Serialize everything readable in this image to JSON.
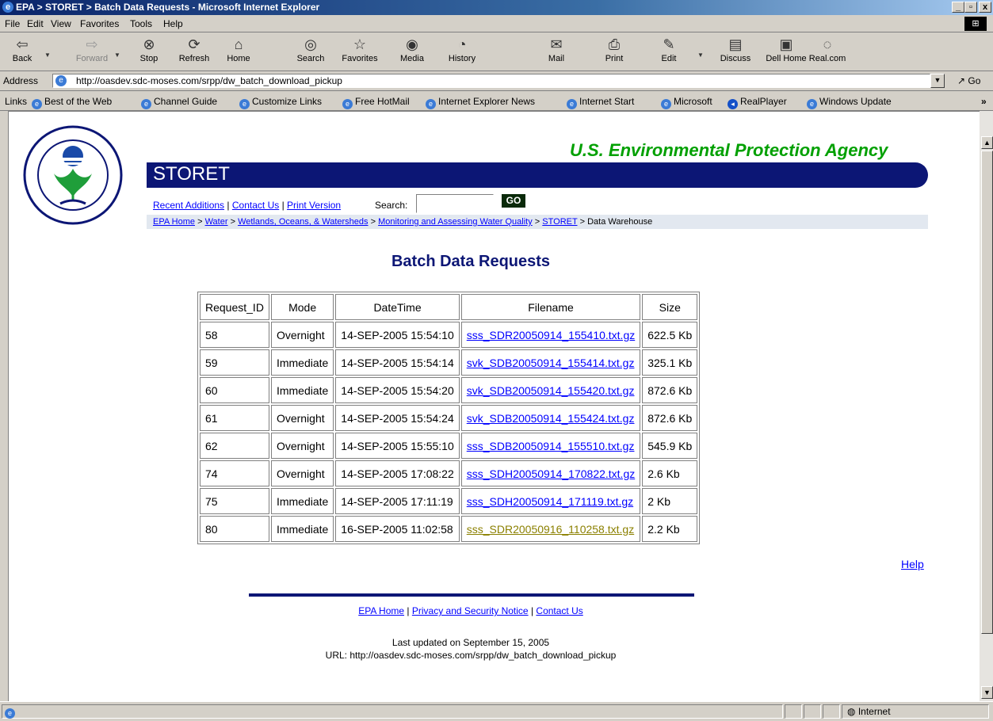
{
  "window": {
    "title": "EPA > STORET > Batch Data Requests - Microsoft Internet Explorer",
    "minimize": "_",
    "maximize": "▫",
    "close": "x"
  },
  "menu": [
    "File",
    "Edit",
    "View",
    "Favorites",
    "Tools",
    "Help"
  ],
  "toolbar": {
    "back": "Back",
    "forward": "Forward",
    "stop": "Stop",
    "refresh": "Refresh",
    "home": "Home",
    "search": "Search",
    "favorites": "Favorites",
    "media": "Media",
    "history": "History",
    "mail": "Mail",
    "print": "Print",
    "edit": "Edit",
    "discuss": "Discuss",
    "dellhome": "Dell Home",
    "real": "Real.com"
  },
  "address": {
    "label": "Address",
    "url": "http://oasdev.sdc-moses.com/srpp/dw_batch_download_pickup",
    "go": "Go"
  },
  "links": {
    "label": "Links",
    "items": [
      "Best of the Web",
      "Channel Guide",
      "Customize Links",
      "Free HotMail",
      "Internet Explorer News",
      "Internet Start",
      "Microsoft",
      "RealPlayer",
      "Windows Update"
    ]
  },
  "page": {
    "agency": "U.S. Environmental Protection Agency",
    "storet": "STORET",
    "nav": {
      "recent": "Recent Additions",
      "contact": "Contact Us",
      "print": "Print Version",
      "sep": "|"
    },
    "search_label": "Search:",
    "search_value": "",
    "go": "GO",
    "breadcrumb": {
      "epa_home": "EPA Home",
      "water": "Water",
      "wetlands": "Wetlands, Oceans, & Watersheds",
      "monitoring": "Monitoring and Assessing Water Quality",
      "storet": "STORET",
      "current": "Data Warehouse",
      "sep": ">"
    },
    "heading": "Batch Data Requests",
    "table": {
      "headers": [
        "Request_ID",
        "Mode",
        "DateTime",
        "Filename",
        "Size"
      ],
      "rows": [
        [
          "58",
          "Overnight",
          "14-SEP-2005 15:54:10",
          "sss_SDR20050914_155410.txt.gz",
          "622.5 Kb"
        ],
        [
          "59",
          "Immediate",
          "14-SEP-2005 15:54:14",
          "svk_SDB20050914_155414.txt.gz",
          "325.1 Kb"
        ],
        [
          "60",
          "Immediate",
          "14-SEP-2005 15:54:20",
          "svk_SDB20050914_155420.txt.gz",
          "872.6 Kb"
        ],
        [
          "61",
          "Overnight",
          "14-SEP-2005 15:54:24",
          "svk_SDB20050914_155424.txt.gz",
          "872.6 Kb"
        ],
        [
          "62",
          "Overnight",
          "14-SEP-2005 15:55:10",
          "sss_SDB20050914_155510.txt.gz",
          "545.9 Kb"
        ],
        [
          "74",
          "Overnight",
          "14-SEP-2005 17:08:22",
          "sss_SDH20050914_170822.txt.gz",
          "2.6 Kb"
        ],
        [
          "75",
          "Immediate",
          "14-SEP-2005 17:11:19",
          "sss_SDH20050914_171119.txt.gz",
          "2 Kb"
        ],
        [
          "80",
          "Immediate",
          "16-SEP-2005 11:02:58",
          "sss_SDR20050916_110258.txt.gz",
          "2.2 Kb"
        ]
      ]
    },
    "help": "Help",
    "footer": {
      "epa_home": "EPA Home",
      "privacy": "Privacy and Security Notice",
      "contact": "Contact Us",
      "sep": "|",
      "updated": "Last updated on September 15, 2005",
      "url": "URL: http://oasdev.sdc-moses.com/srpp/dw_batch_download_pickup"
    },
    "seal_text": {
      "top": "UNITED STATES",
      "left": "ENVIRONMENTAL",
      "right": "AGENCY",
      "bottom": "PROTECTION"
    }
  },
  "status": {
    "zone": "Internet"
  },
  "colors": {
    "agency_green": "#00a000",
    "navy": "#0c1675",
    "link": "#0000ff",
    "visited": "#8b8000"
  }
}
